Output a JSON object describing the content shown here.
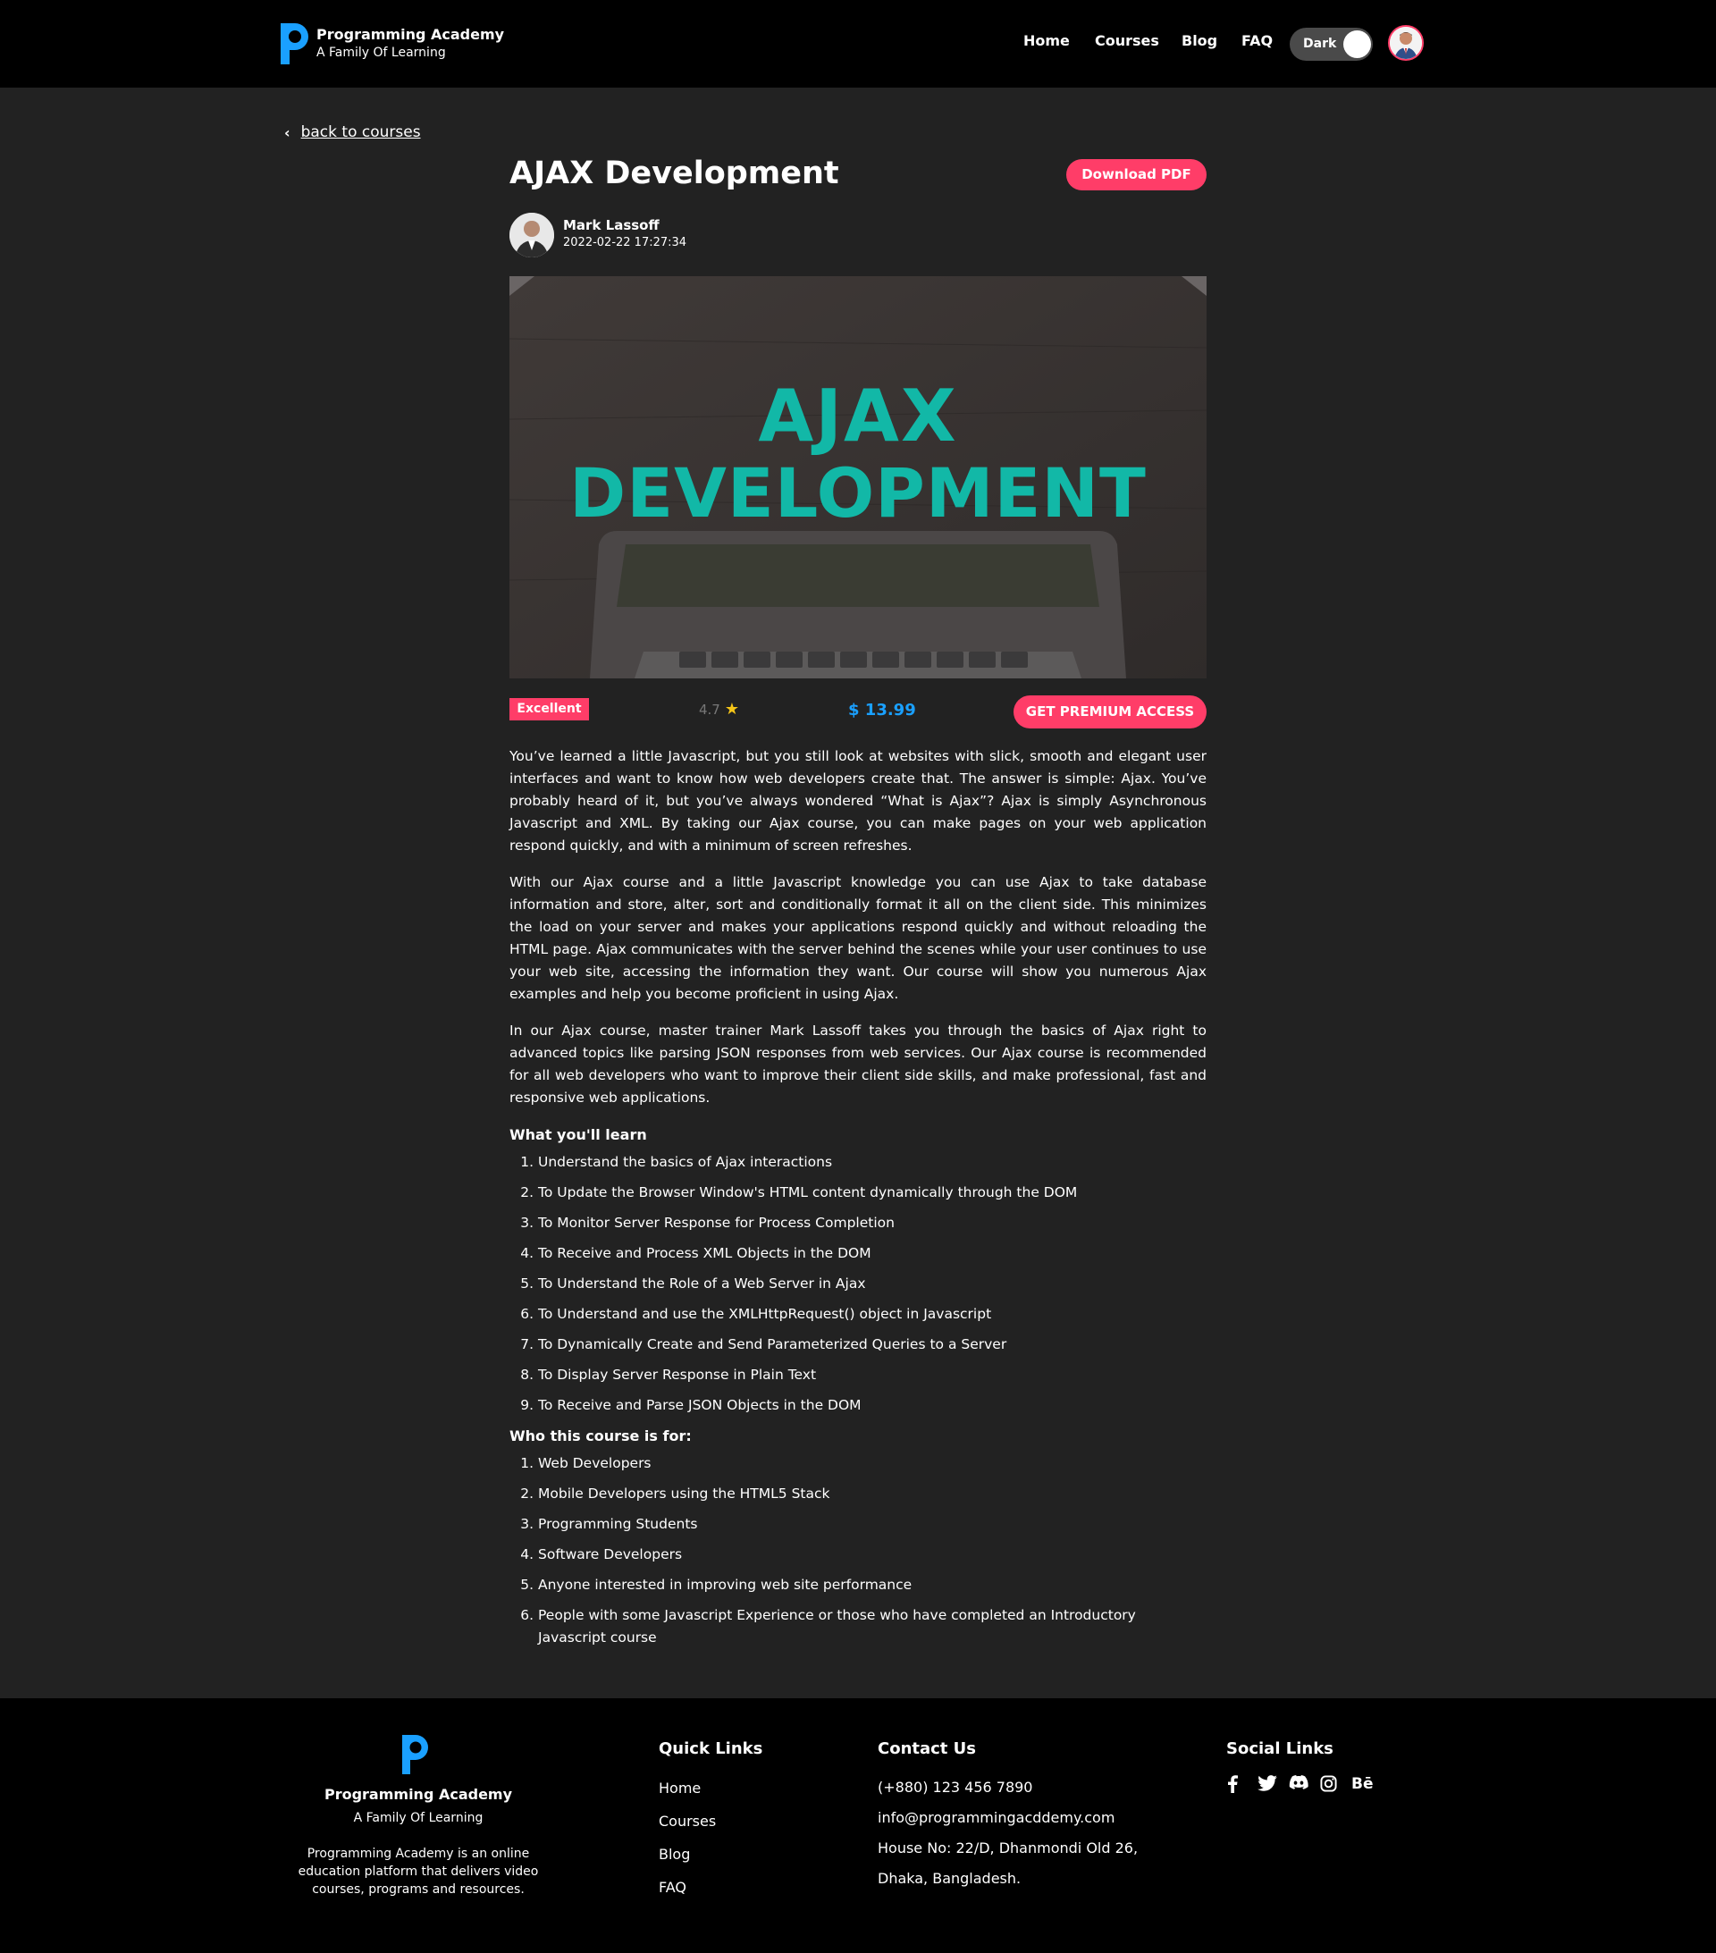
{
  "header": {
    "brand_title": "Programming Academy",
    "brand_subtitle": "A Family Of Learning",
    "nav": [
      "Home",
      "Courses",
      "Blog",
      "FAQ"
    ],
    "theme_toggle_label": "Dark"
  },
  "back_link": "back to courses",
  "course": {
    "title": "AJAX Development",
    "download_label": "Download PDF",
    "author_name": "Mark Lassoff",
    "author_date": "2022-02-22 17:27:34",
    "hero_line1": "AJAX",
    "hero_line2": "DEVELOPMENT",
    "badge": "Excellent",
    "rating": "4.7",
    "price": "$ 13.99",
    "premium_label": "GET PREMIUM ACCESS",
    "paragraphs": [
      "You’ve learned a little Javascript, but you still look at websites with slick, smooth and elegant user interfaces and want to know how web developers create that. The answer is simple: Ajax. You’ve probably heard of it, but you’ve always wondered “What is Ajax”? Ajax is simply Asynchronous Javascript and XML. By taking our Ajax course, you can make pages on your web application respond quickly, and with a minimum of screen refreshes.",
      "With our Ajax course and a little Javascript knowledge you can use Ajax to take database information and store, alter, sort and conditionally format it all on the client side. This minimizes the load on your server and makes your applications respond quickly and without reloading the HTML page. Ajax communicates with the server behind the scenes while your user continues to use your web site, accessing the information they want. Our course will show you numerous Ajax examples and help you become proficient in using Ajax.",
      "In our Ajax course, master trainer Mark Lassoff takes you through the basics of Ajax right to advanced topics like parsing JSON responses from web services. Our Ajax course is recommended for all web developers who want to improve their client side skills, and make professional, fast and responsive web applications."
    ],
    "learn_heading": "What you'll learn",
    "learn_items": [
      "Understand the basics of Ajax interactions",
      "To Update the Browser Window's HTML content dynamically through the DOM",
      "To Monitor Server Response for Process Completion",
      "To Receive and Process XML Objects in the DOM",
      "To Understand the Role of a Web Server in Ajax",
      "To Understand and use the XMLHttpRequest() object in Javascript",
      "To Dynamically Create and Send Parameterized Queries to a Server",
      "To Display Server Response in Plain Text",
      "To Receive and Parse JSON Objects in the DOM"
    ],
    "audience_heading": "Who this course is for:",
    "audience_items": [
      "Web Developers",
      "Mobile Developers using the HTML5 Stack",
      "Programming Students",
      "Software Developers",
      "Anyone interested in improving web site performance",
      "People with some Javascript Experience or those who have completed an Introductory Javascript course"
    ]
  },
  "footer": {
    "brand_title": "Programming Academy",
    "brand_subtitle": "A Family Of Learning",
    "description": "Programming Academy is an online education platform that delivers video courses, programs and resources.",
    "quick_links_heading": "Quick Links",
    "quick_links": [
      "Home",
      "Courses",
      "Blog",
      "FAQ"
    ],
    "contact_heading": "Contact Us",
    "phone": "(+880) 123 456 7890",
    "email": "info@programmingacddemy.com",
    "address_line1": "House No: 22/D, Dhanmondi Old 26,",
    "address_line2": "Dhaka, Bangladesh.",
    "social_heading": "Social Links",
    "social_icons": [
      "facebook-icon",
      "twitter-icon",
      "discord-icon",
      "instagram-icon",
      "behance-icon"
    ],
    "behance_label": "Bē"
  },
  "colors": {
    "accent": "#ff3d68",
    "price": "#1aa0ff",
    "logo_blue": "#1aa0ff",
    "hero_text": "#12b8a7"
  }
}
